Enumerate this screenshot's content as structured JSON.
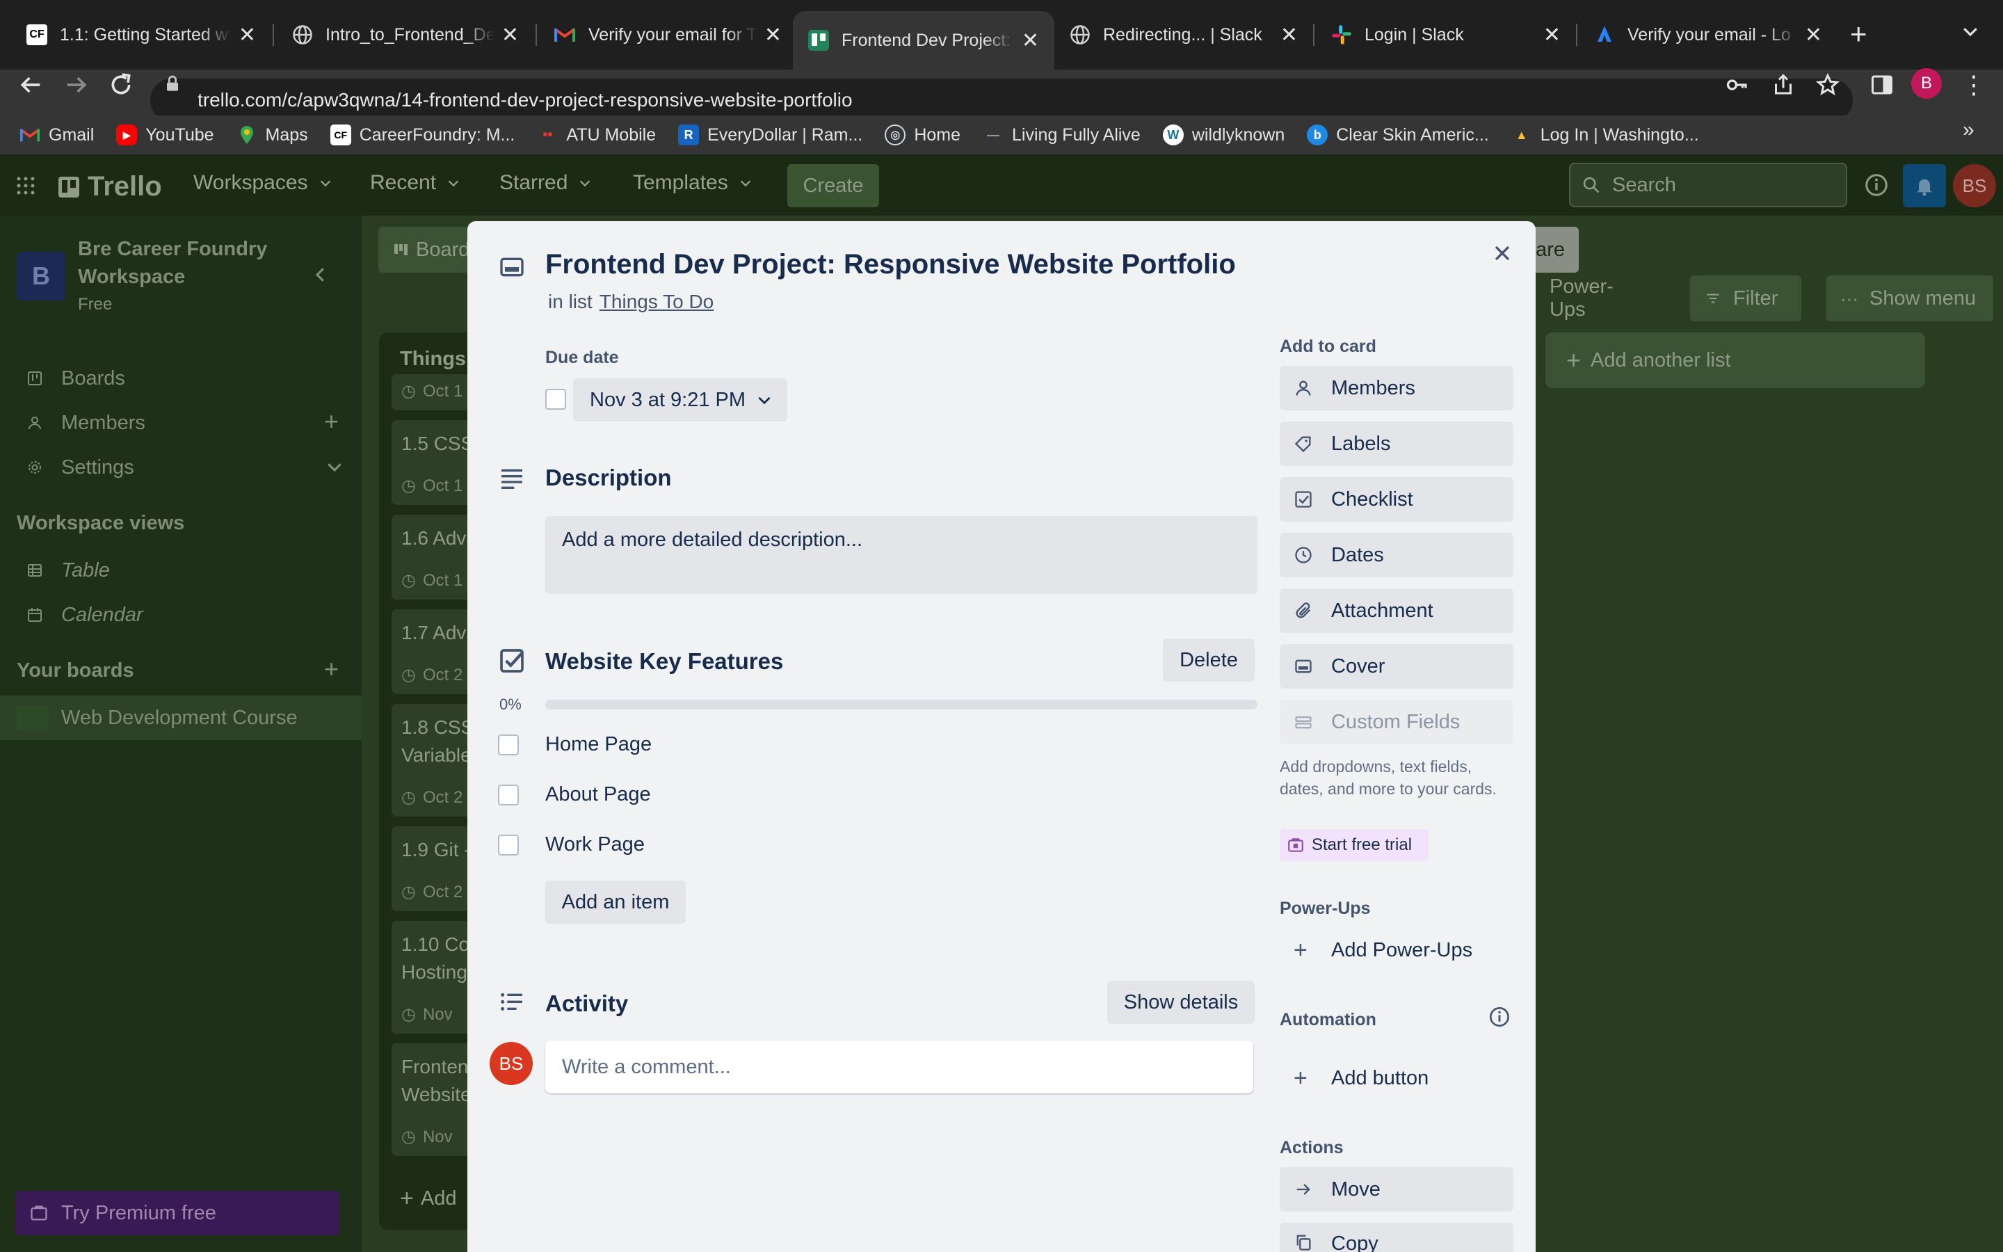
{
  "browser": {
    "tabs": [
      {
        "title": "1.1: Getting Started w",
        "icon": "careerfoundry-icon"
      },
      {
        "title": "Intro_to_Frontend_De",
        "icon": "globe-icon"
      },
      {
        "title": "Verify your email for T",
        "icon": "gmail-icon"
      },
      {
        "title": "Frontend Dev Project:",
        "icon": "trello-icon",
        "active": true
      },
      {
        "title": "Redirecting... | Slack",
        "icon": "globe-icon"
      },
      {
        "title": "Login | Slack",
        "icon": "slack-icon"
      },
      {
        "title": "Verify your email - Lo",
        "icon": "atlassian-icon"
      }
    ],
    "url": "trello.com/c/apw3qwna/14-frontend-dev-project-responsive-website-portfolio",
    "profile_initial": "B",
    "bookmarks": [
      {
        "label": "Gmail",
        "color": "#ea4335",
        "glyph": "M"
      },
      {
        "label": "YouTube",
        "color": "#ff0000",
        "glyph": "▶"
      },
      {
        "label": "Maps",
        "color": "#34a853",
        "glyph": "●"
      },
      {
        "label": "CareerFoundry: M...",
        "color": "#ffffff",
        "glyph": "CF"
      },
      {
        "label": "ATU Mobile",
        "color": "#c62828",
        "glyph": "••"
      },
      {
        "label": "EveryDollar | Ram...",
        "color": "#1565c0",
        "glyph": "R"
      },
      {
        "label": "Home",
        "color": "#90a4ae",
        "glyph": "◎"
      },
      {
        "label": "Living Fully Alive",
        "color": "#455a64",
        "glyph": "—"
      },
      {
        "label": "wildlyknown",
        "color": "#ffffff",
        "glyph": "W"
      },
      {
        "label": "Clear Skin Americ...",
        "color": "#1e88e5",
        "glyph": "b"
      },
      {
        "label": "Log In | Washingto...",
        "color": "#fbc02d",
        "glyph": "▲"
      }
    ],
    "more_bookmarks": "»"
  },
  "trello_header": {
    "logo": "Trello",
    "nav": [
      "Workspaces",
      "Recent",
      "Starred",
      "Templates"
    ],
    "create": "Create",
    "search_placeholder": "Search",
    "avatar": "BS"
  },
  "sidebar": {
    "workspace_initial": "B",
    "workspace_name": "Bre Career Foundry Workspace",
    "plan": "Free",
    "items": [
      "Boards",
      "Members",
      "Settings"
    ],
    "views_heading": "Workspace views",
    "views": [
      "Table",
      "Calendar"
    ],
    "boards_heading": "Your boards",
    "boards": [
      "Web Development Course"
    ],
    "premium": "Try Premium free"
  },
  "board": {
    "board_tab": "Board",
    "share_partial": "are",
    "power_ups": "Power-Ups",
    "filter": "Filter",
    "show_menu": "Show menu",
    "add_list": "Add another list",
    "list_title": "Things",
    "cards": [
      {
        "title": "",
        "date": "Oct 1"
      },
      {
        "title": "1.5 CSS",
        "date": "Oct 1"
      },
      {
        "title": "1.6 Adva",
        "date": "Oct 1"
      },
      {
        "title": "1.7 Adva",
        "date": "Oct 2"
      },
      {
        "title": "1.8 CSS",
        "title2": "Variable",
        "date": "Oct 2"
      },
      {
        "title": "1.9 Git -",
        "date": "Oct 2"
      },
      {
        "title": "1.10 Co",
        "title2": "Hosting",
        "date": "Nov"
      },
      {
        "title": "Fronten",
        "title2": "Website",
        "date": "Nov"
      }
    ],
    "add_card": "Add"
  },
  "card": {
    "title": "Frontend Dev Project: Responsive Website Portfolio",
    "in_list_prefix": "in list",
    "list_name": "Things To Do",
    "due_label": "Due date",
    "due_value": "Nov 3 at 9:21 PM",
    "description_heading": "Description",
    "description_placeholder": "Add a more detailed description...",
    "checklist": {
      "title": "Website Key Features",
      "delete": "Delete",
      "progress_label": "0%",
      "progress": 0,
      "items": [
        "Home Page",
        "About Page",
        "Work Page"
      ],
      "add_item": "Add an item"
    },
    "activity_heading": "Activity",
    "show_details": "Show details",
    "comment_avatar": "BS",
    "comment_placeholder": "Write a comment..."
  },
  "card_sidebar": {
    "add_to_card": "Add to card",
    "buttons": [
      "Members",
      "Labels",
      "Checklist",
      "Dates",
      "Attachment",
      "Cover",
      "Custom Fields"
    ],
    "custom_fields_note": "Add dropdowns, text fields, dates, and more to your cards.",
    "trial": "Start free trial",
    "power_ups_heading": "Power-Ups",
    "add_power_ups": "Add Power-Ups",
    "automation_heading": "Automation",
    "add_button": "Add button",
    "actions_heading": "Actions",
    "actions": [
      "Move",
      "Copy"
    ]
  },
  "colors": {
    "trello_overlay_bg": "#2a3d21",
    "modal_bg": "#f1f2f4",
    "text_primary": "#172b4d",
    "avatar_red": "#d9371f",
    "notif_blue": "#0c66a4",
    "premium_purple": "#5b2a83"
  }
}
